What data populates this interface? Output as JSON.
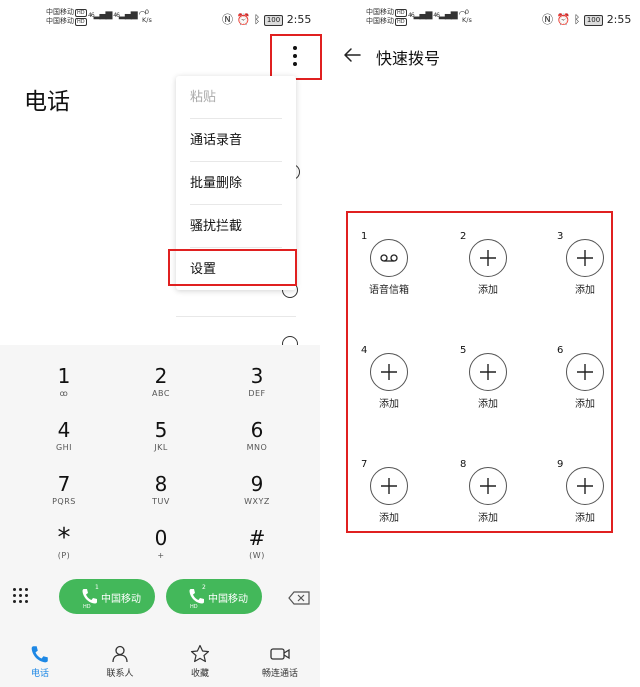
{
  "status_bar": {
    "carrier1": "中国移动",
    "carrier2": "中国移动",
    "hd": "HD",
    "signal": "46",
    "speed_value": "0",
    "speed_unit": "K/s",
    "battery": "100",
    "time": "2:55"
  },
  "left": {
    "title": "电话",
    "menu": [
      {
        "label": "粘贴",
        "enabled": false
      },
      {
        "label": "通话录音",
        "enabled": true
      },
      {
        "label": "批量删除",
        "enabled": true
      },
      {
        "label": "骚扰拦截",
        "enabled": true
      },
      {
        "label": "设置",
        "enabled": true
      }
    ],
    "keys": [
      {
        "digit": "1",
        "letters": "ꝏ"
      },
      {
        "digit": "2",
        "letters": "ABC"
      },
      {
        "digit": "3",
        "letters": "DEF"
      },
      {
        "digit": "4",
        "letters": "GHI"
      },
      {
        "digit": "5",
        "letters": "JKL"
      },
      {
        "digit": "6",
        "letters": "MNO"
      },
      {
        "digit": "7",
        "letters": "PQRS"
      },
      {
        "digit": "8",
        "letters": "TUV"
      },
      {
        "digit": "9",
        "letters": "WXYZ"
      },
      {
        "digit": "*",
        "letters": "(P)"
      },
      {
        "digit": "0",
        "letters": "+"
      },
      {
        "digit": "#",
        "letters": "(W)"
      }
    ],
    "call_buttons": [
      {
        "sim": "1",
        "hd": "HD",
        "label": "中国移动"
      },
      {
        "sim": "2",
        "hd": "HD",
        "label": "中国移动"
      }
    ],
    "nav": [
      {
        "label": "电话",
        "icon": "phone-icon",
        "active": true
      },
      {
        "label": "联系人",
        "icon": "contacts-icon",
        "active": false
      },
      {
        "label": "收藏",
        "icon": "star-icon",
        "active": false
      },
      {
        "label": "畅连通话",
        "icon": "video-call-icon",
        "active": false
      }
    ],
    "accent_color": "#43b85a",
    "nav_active_color": "#1e88e5",
    "highlight_color": "#e02020"
  },
  "right": {
    "title": "快速拨号",
    "slots": [
      {
        "num": "1",
        "label": "语音信箱",
        "icon": "voicemail-icon"
      },
      {
        "num": "2",
        "label": "添加",
        "icon": "plus-icon"
      },
      {
        "num": "3",
        "label": "添加",
        "icon": "plus-icon"
      },
      {
        "num": "4",
        "label": "添加",
        "icon": "plus-icon"
      },
      {
        "num": "5",
        "label": "添加",
        "icon": "plus-icon"
      },
      {
        "num": "6",
        "label": "添加",
        "icon": "plus-icon"
      },
      {
        "num": "7",
        "label": "添加",
        "icon": "plus-icon"
      },
      {
        "num": "8",
        "label": "添加",
        "icon": "plus-icon"
      },
      {
        "num": "9",
        "label": "添加",
        "icon": "plus-icon"
      }
    ]
  }
}
